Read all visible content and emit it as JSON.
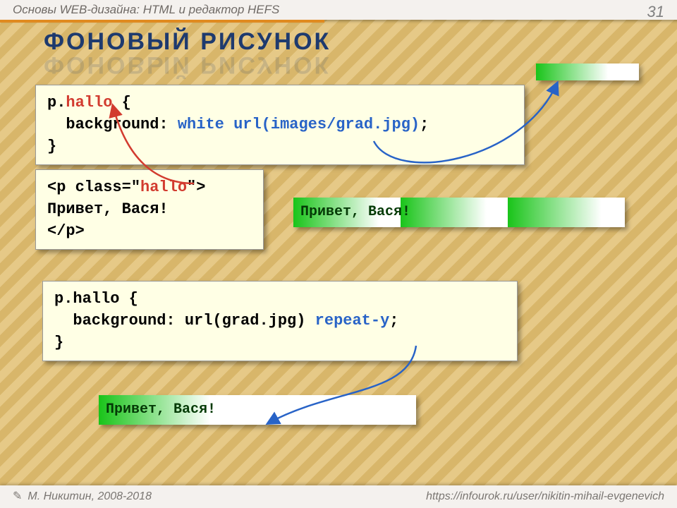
{
  "header": {
    "subtitle": "Основы WEB-дизайна: HTML и редактор HEFS",
    "slide_number": "31"
  },
  "title": "ФОНОВЫЙ РИСУНОК",
  "code1": {
    "selector_p": "p",
    "selector_dot": ".",
    "class_name": "hallo",
    "open_brace": " {",
    "prop_indent": "  background: ",
    "prop_white": "white",
    "space": " ",
    "url_part": "url(images/grad.jpg)",
    "semicolon": ";",
    "close": "}"
  },
  "code2": {
    "tag_open1": "<p class=\"",
    "class_name": "hallo",
    "tag_open2": "\">",
    "greeting": "Привет, Вася!",
    "tag_close": "</p>"
  },
  "code3": {
    "line1": "p.hallo {",
    "line2a": "  background: url(grad.jpg) ",
    "repeat": "repeat-y",
    "line2b": ";",
    "close": "}"
  },
  "greet1": "Привет, Вася!",
  "greet2": "Привет, Вася!",
  "footer": {
    "author": "М. Никитин, 2008-2018",
    "url": "https://infourok.ru/user/nikitin-mihail-evgenevich"
  },
  "colors": {
    "grad_green": "#19c419",
    "grad_white": "#ffffff"
  }
}
